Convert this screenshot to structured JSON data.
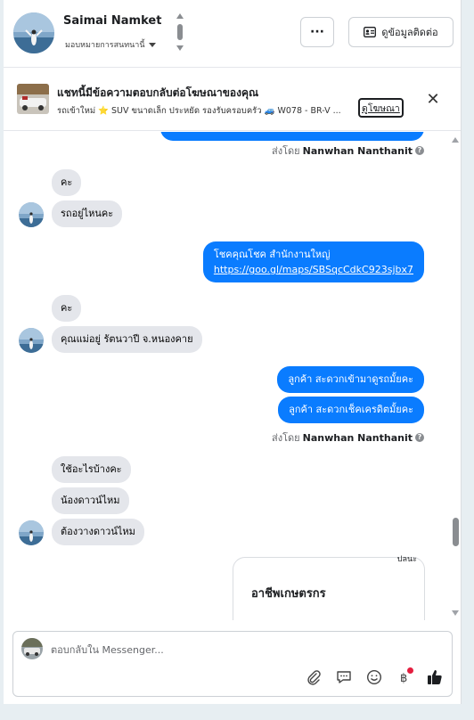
{
  "header": {
    "contact_name": "Saimai Namket",
    "assign_label": "มอบหมายการสนทนานี้",
    "more_label": "···",
    "view_contact_label": "ดูข้อมูลติดต่อ"
  },
  "ad_banner": {
    "title": "แชทนี้มีข้อความตอบกลับต่อโฆษณาของคุณ",
    "description": "รถเข้าใหม่ ⭐ SUV ขนาดเล็ก ประหยัด รองรับครอบครัว 🚙 W078 - BR-V ...",
    "view_ad_label": "ดูโฆษณา",
    "close_label": "✕"
  },
  "messages": {
    "sent_by_label": "ส่งโดย",
    "sender_name": "Nanwhan Nanthanit",
    "incoming_1": "คะ",
    "incoming_2": "รถอยู่ไหนคะ",
    "outgoing_1_line1": "โชคคุณโชค สำนักงานใหญ่",
    "outgoing_1_link": "https://goo.gl/maps/SBSqcCdkC923sjbx7",
    "incoming_3": "คะ",
    "incoming_4": "คุณแม่อยู่ รัตนวาปี จ.หนองคาย",
    "outgoing_2": "ลูกค้า สะดวกเข้ามาดูรถมั้ยคะ",
    "outgoing_3": "ลูกค้า สะดวกเช็คเครดิตมั้ยคะ",
    "incoming_5": "ใช้อะไรบ้างคะ",
    "incoming_6": "น้องดาวน์ไหม",
    "incoming_7": "ต้องวางดาวน์ไหม",
    "card_title": "อาชีพเกษตรกร",
    "card_partial": "ปลนะ"
  },
  "composer": {
    "placeholder": "ตอบกลับใน Messenger..."
  },
  "icons": {
    "attach": "paperclip-icon",
    "saved_replies": "chat-bubble-icon",
    "emoji": "smiley-icon",
    "payment": "baht-icon",
    "like": "thumbs-up-icon"
  },
  "colors": {
    "outgoing_bubble": "#0a7cff",
    "incoming_bubble": "#e4e6eb",
    "notification_dot": "#e41e3f"
  }
}
